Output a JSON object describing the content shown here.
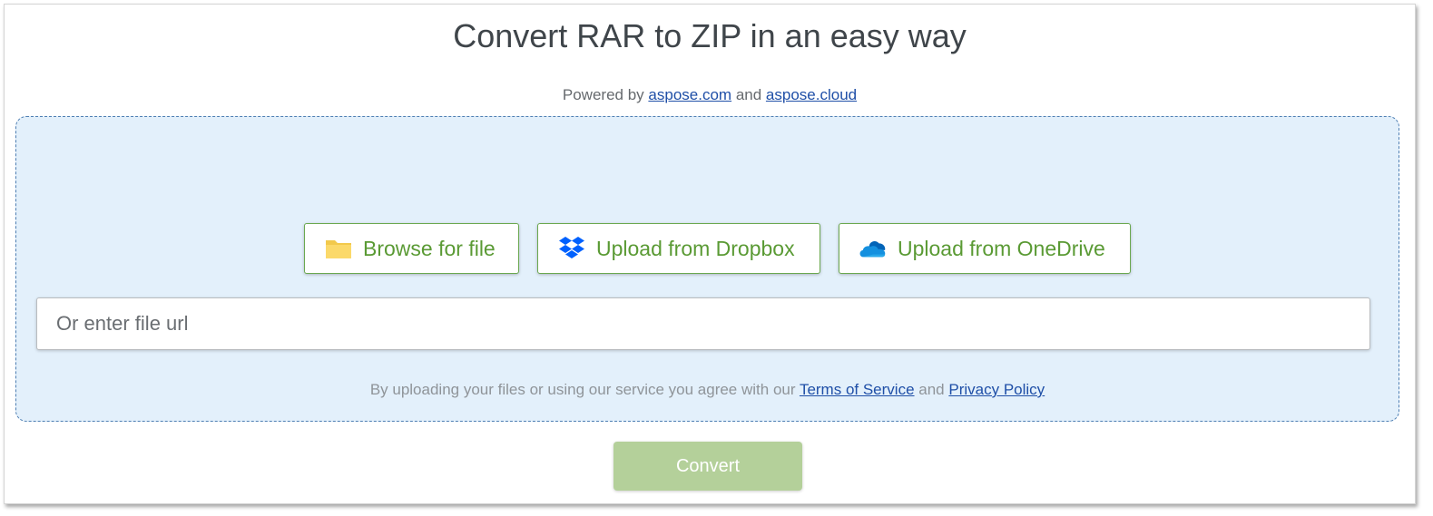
{
  "page": {
    "title": "Convert RAR to ZIP in an easy way"
  },
  "powered": {
    "prefix": "Powered by",
    "link1": "aspose.com",
    "joiner": "and",
    "link2": "aspose.cloud"
  },
  "upload": {
    "browse_label": "Browse for file",
    "browse_icon": "folder-icon",
    "dropbox_label": "Upload from Dropbox",
    "dropbox_icon": "dropbox-icon",
    "onedrive_label": "Upload from OneDrive",
    "onedrive_icon": "onedrive-icon",
    "url_placeholder": "Or enter file url",
    "url_value": ""
  },
  "terms": {
    "prefix": "By uploading your files or using our service you agree with our",
    "tos_link": "Terms of Service",
    "joiner": "and",
    "privacy_link": "Privacy Policy"
  },
  "actions": {
    "convert_label": "Convert"
  },
  "colors": {
    "accent_green": "#5a9a34",
    "convert_disabled": "#b4d09a",
    "dropzone_bg": "#e3f0fb",
    "link_blue": "#1f4fa7"
  }
}
